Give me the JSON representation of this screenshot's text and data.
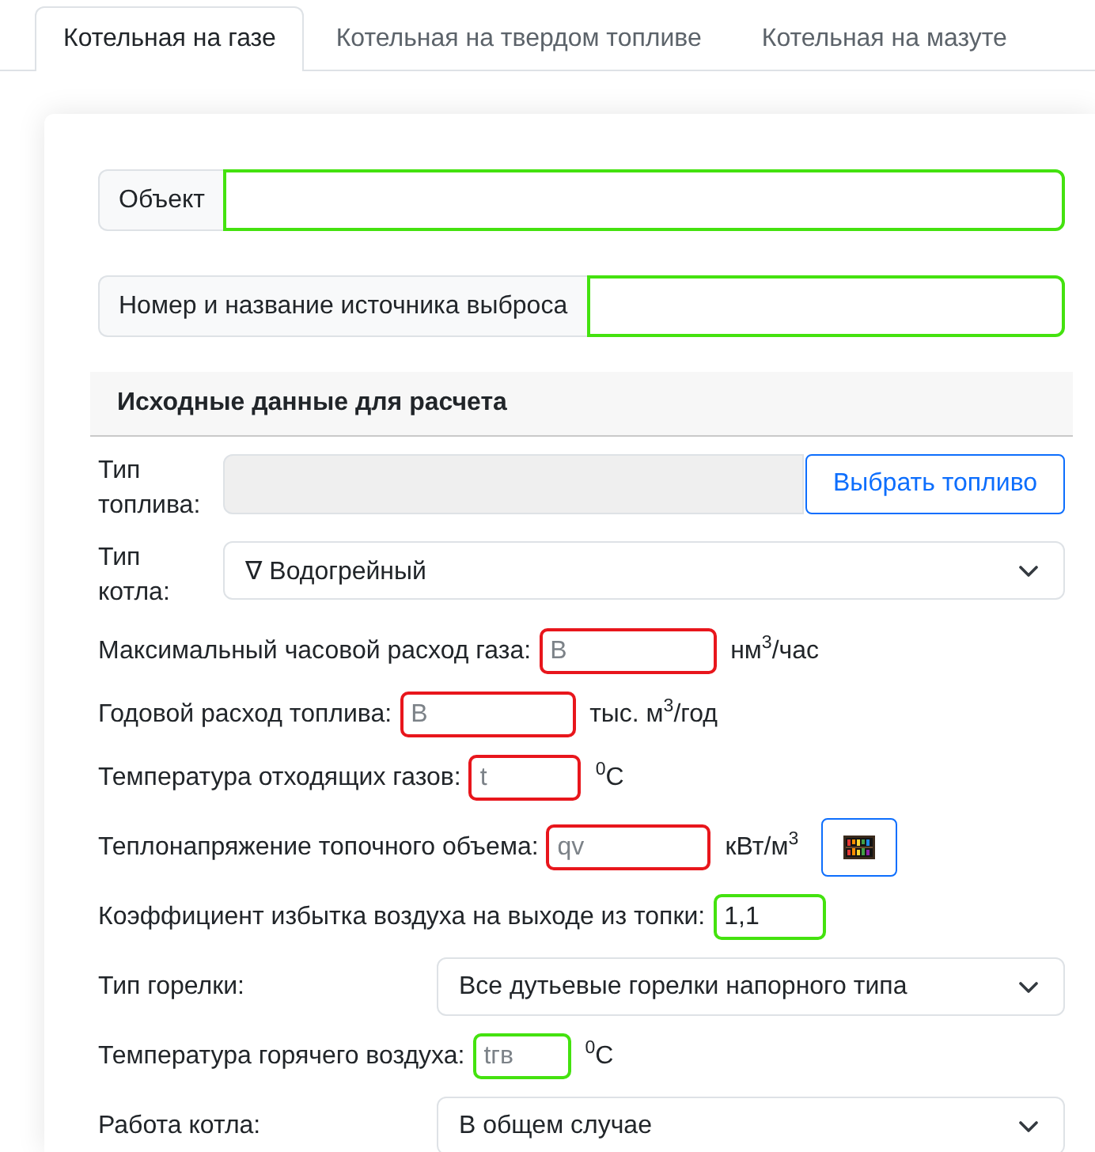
{
  "tabs": [
    {
      "label": "Котельная на газе",
      "selected": true
    },
    {
      "label": "Котельная на твердом топливе",
      "selected": false
    },
    {
      "label": "Котельная на мазуте",
      "selected": false
    }
  ],
  "header_fields": [
    {
      "label": "Объект",
      "valid": true
    },
    {
      "label": "Номер и название источника выброса",
      "valid": true
    }
  ],
  "section": {
    "title": "Исходные данные для расчета"
  },
  "rows": [
    {
      "kind": "picker",
      "label": "Тип топлива:",
      "disabled": true,
      "button": "Выбрать топливо"
    },
    {
      "kind": "select",
      "label": "Тип котла:",
      "value": "∇ Водогрейный"
    },
    {
      "kind": "input",
      "label": "Максимальный часовой расход газа:",
      "placeholder": "B",
      "valid": false,
      "unit": "нм$^{3}$/час"
    },
    {
      "kind": "input",
      "label": "Годовой расход топлива:",
      "placeholder": "B",
      "valid": false,
      "unit": "тыс. м$^{3}$/год"
    },
    {
      "kind": "input",
      "label": "Температура отходящих газов:",
      "placeholder": "t",
      "valid": false,
      "unit": "$^{0}$C"
    },
    {
      "kind": "input",
      "label": "Теплонапряжение топочного объема:",
      "placeholder": "qv",
      "valid": false,
      "unit": "кВт/м$^{3}$",
      "calculator": true
    },
    {
      "kind": "input",
      "label": "Коэффициент избытка воздуха на выходе из топки:",
      "value": "1,1",
      "valid": true
    },
    {
      "kind": "select",
      "label": "Тип горелки:",
      "value": "Все дутьевые горелки напорного типа"
    },
    {
      "kind": "input",
      "label": "Температура горячего воздуха:",
      "placeholder": "tгв",
      "valid": true,
      "unit": "$^{0}$C"
    },
    {
      "kind": "select",
      "label": "Работа котла:",
      "value": "В общем случае"
    }
  ]
}
